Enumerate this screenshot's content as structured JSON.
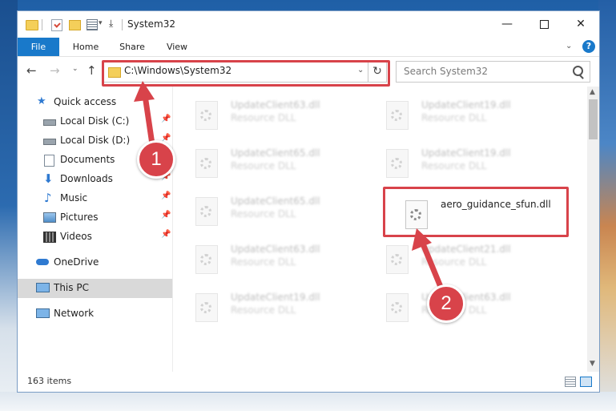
{
  "window": {
    "title": "System32"
  },
  "window_controls": {
    "minimize": "—",
    "close": "✕"
  },
  "ribbon": {
    "tabs": [
      "File",
      "Home",
      "Share",
      "View"
    ],
    "help": "?"
  },
  "address_bar": {
    "path": "C:\\Windows\\System32"
  },
  "search": {
    "placeholder": "Search System32"
  },
  "sidebar": {
    "items": [
      {
        "label": "Quick access",
        "icon": "star-icon",
        "pinned": false
      },
      {
        "label": "Local Disk (C:)",
        "icon": "drive-icon",
        "pinned": true
      },
      {
        "label": "Local Disk (D:)",
        "icon": "drive-icon",
        "pinned": true
      },
      {
        "label": "Documents",
        "icon": "documents-icon",
        "pinned": true
      },
      {
        "label": "Downloads",
        "icon": "downloads-icon",
        "pinned": true
      },
      {
        "label": "Music",
        "icon": "music-icon",
        "pinned": true
      },
      {
        "label": "Pictures",
        "icon": "pictures-icon",
        "pinned": true
      },
      {
        "label": "Videos",
        "icon": "videos-icon",
        "pinned": true
      },
      {
        "label": "OneDrive",
        "icon": "cloud-icon",
        "pinned": false
      },
      {
        "label": "This PC",
        "icon": "computer-icon",
        "pinned": false,
        "selected": true
      },
      {
        "label": "Network",
        "icon": "network-icon",
        "pinned": false
      }
    ]
  },
  "files": [
    {
      "name": "UpdateClient63.dll",
      "type": "Resource DLL"
    },
    {
      "name": "UpdateClient19.dll",
      "type": "Resource DLL"
    },
    {
      "name": "UpdateClient65.dll",
      "type": "Resource DLL"
    },
    {
      "name": "UpdateClient19.dll",
      "type": "Resource DLL"
    },
    {
      "name": "UpdateClient65.dll",
      "type": "Resource DLL"
    },
    {
      "name": "aero_guidance_sfun.dll",
      "type": ""
    },
    {
      "name": "UpdateClient63.dll",
      "type": "Resource DLL"
    },
    {
      "name": "UpdateClient21.dll",
      "type": "Resource DLL"
    },
    {
      "name": "UpdateClient19.dll",
      "type": "Resource DLL"
    },
    {
      "name": "UpdateClient63.dll",
      "type": "Resource DLL"
    }
  ],
  "status": {
    "item_count": "163 items"
  },
  "annotations": {
    "badge1": "1",
    "badge2": "2",
    "color": "#d8434a"
  }
}
